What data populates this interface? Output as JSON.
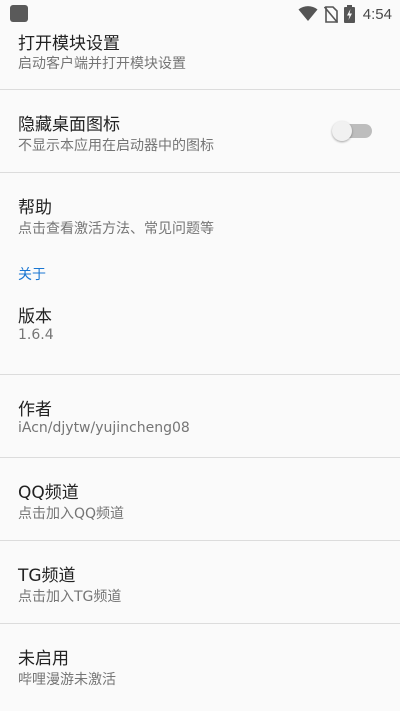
{
  "status_bar": {
    "time": "4:54",
    "icons": [
      "app-icon",
      "wifi-icon",
      "no-sim-icon",
      "battery-charging-icon"
    ]
  },
  "settings": {
    "open_module": {
      "title": "打开模块设置",
      "summary": "启动客户端并打开模块设置"
    },
    "hide_icon": {
      "title": "隐藏桌面图标",
      "summary": "不显示本应用在启动器中的图标",
      "switch_on": false
    },
    "help": {
      "title": "帮助",
      "summary": "点击查看激活方法、常见问题等"
    },
    "about_category": "关于",
    "version": {
      "title": "版本",
      "summary": "1.6.4"
    },
    "author": {
      "title": "作者",
      "summary": "iAcn/djytw/yujincheng08"
    },
    "qq_channel": {
      "title": "QQ频道",
      "summary": "点击加入QQ频道"
    },
    "tg_channel": {
      "title": "TG频道",
      "summary": "点击加入TG频道"
    },
    "status": {
      "title": "未启用",
      "summary": "哔哩漫游未激活"
    }
  },
  "colors": {
    "accent": "#1976d2",
    "background": "#fafafa",
    "divider": "#dcdcdc",
    "title_text": "#222222",
    "summary_text": "#757575"
  }
}
